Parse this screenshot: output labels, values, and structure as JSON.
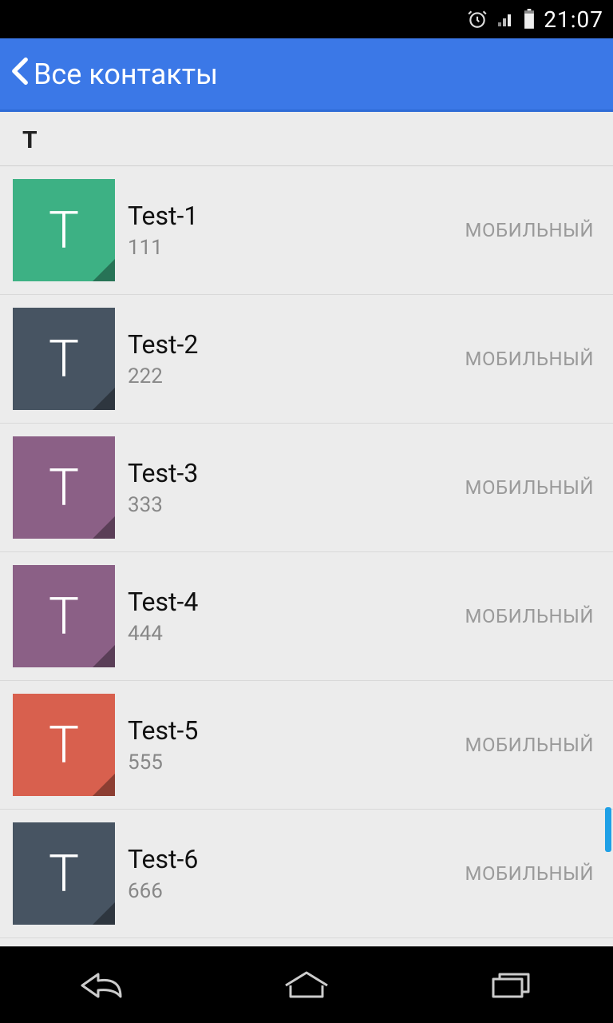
{
  "status": {
    "time": "21:07"
  },
  "header": {
    "title": "Все контакты"
  },
  "section": {
    "letter": "Т"
  },
  "contacts": [
    {
      "letter": "T",
      "name": "Test-1",
      "number": "111",
      "type": "МОБИЛЬНЫЙ",
      "color": "#3DB184"
    },
    {
      "letter": "T",
      "name": "Test-2",
      "number": "222",
      "type": "МОБИЛЬНЫЙ",
      "color": "#475462"
    },
    {
      "letter": "T",
      "name": "Test-3",
      "number": "333",
      "type": "МОБИЛЬНЫЙ",
      "color": "#8B6086"
    },
    {
      "letter": "T",
      "name": "Test-4",
      "number": "444",
      "type": "МОБИЛЬНЫЙ",
      "color": "#8B6086"
    },
    {
      "letter": "T",
      "name": "Test-5",
      "number": "555",
      "type": "МОБИЛЬНЫЙ",
      "color": "#D8604E"
    },
    {
      "letter": "T",
      "name": "Test-6",
      "number": "666",
      "type": "МОБИЛЬНЫЙ",
      "color": "#475462"
    }
  ]
}
